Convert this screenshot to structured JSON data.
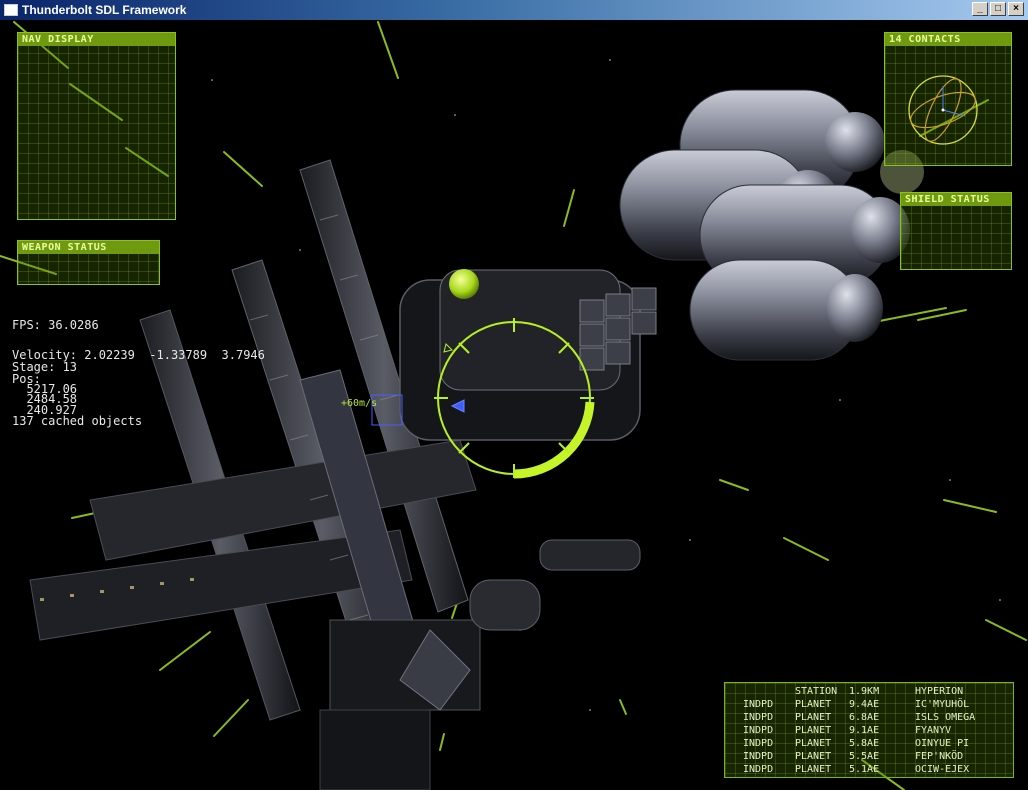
{
  "window": {
    "title": "Thunderbolt SDL Framework",
    "buttons": {
      "minimize": "_",
      "maximize": "□",
      "close": "×"
    }
  },
  "hud": {
    "nav_display": "NAV DISPLAY",
    "contacts_count": "14 CONTACTS",
    "weapon_status": "WEAPON STATUS",
    "shield_status": "SHIELD STATUS",
    "velocity_marker": "+60m/s"
  },
  "stats": {
    "fps": "FPS: 36.0286",
    "velocity": "Velocity: 2.02239  -1.33789  3.7946",
    "stage": "Stage: 13",
    "pos_label": "Pos:",
    "pos_x": "  5217.06",
    "pos_y": "  2484.58",
    "pos_z": "  240.927",
    "cached": "137 cached objects"
  },
  "contacts": {
    "header": {
      "type": "STATION",
      "dist": "1.9km",
      "name": "HYPERION"
    },
    "rows": [
      {
        "faction": "INDPD",
        "type": "PLANET",
        "dist": "9.4ae",
        "name": "Ic'Myuhöl"
      },
      {
        "faction": "INDPD",
        "type": "PLANET",
        "dist": "6.8ae",
        "name": "Isls Omega"
      },
      {
        "faction": "INDPD",
        "type": "PLANET",
        "dist": "9.1ae",
        "name": "Fyanyv"
      },
      {
        "faction": "INDPD",
        "type": "PLANET",
        "dist": "5.8ae",
        "name": "Oinyue Pi"
      },
      {
        "faction": "INDPD",
        "type": "PLANET",
        "dist": "5.5ae",
        "name": "Fep'Nköd"
      },
      {
        "faction": "INDPD",
        "type": "PLANET",
        "dist": "5.1ae",
        "name": "Ociw-Ejex"
      }
    ]
  },
  "colors": {
    "hud_green": "#8bc21a",
    "reticle": "#b7f020",
    "streak": "#9bd11f",
    "panel_header": "#6f9a10"
  }
}
